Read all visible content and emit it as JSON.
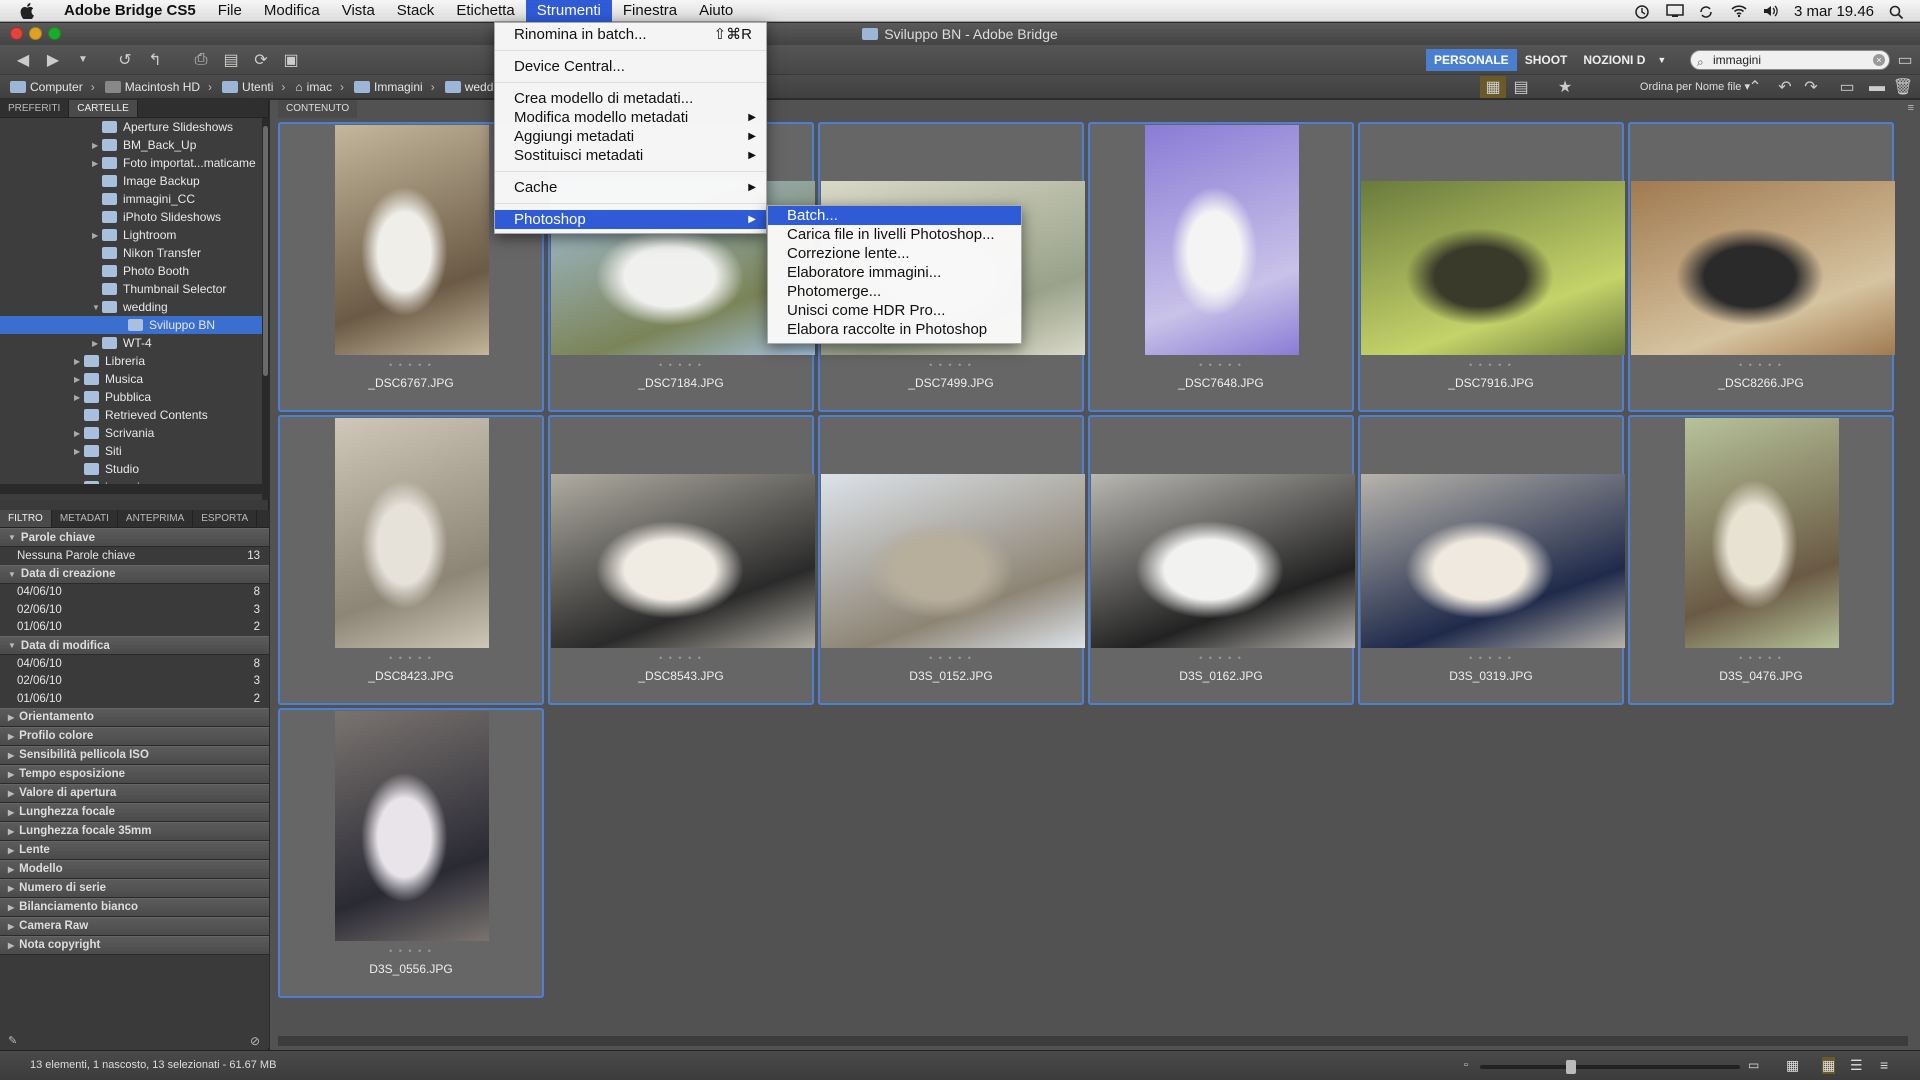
{
  "menubar": {
    "app": "Adobe Bridge CS5",
    "items": [
      "File",
      "Modifica",
      "Vista",
      "Stack",
      "Etichetta",
      "Strumenti",
      "Finestra",
      "Aiuto"
    ],
    "clock": "3 mar 19.46"
  },
  "window": {
    "title": "Sviluppo BN - Adobe Bridge"
  },
  "workspaces": [
    "PERSONALE",
    "SHOOT",
    "NOZIONI D"
  ],
  "search": {
    "value": "immagini"
  },
  "path": [
    "Computer",
    "Macintosh HD",
    "Utenti",
    "imac",
    "Immagini",
    "wedd"
  ],
  "sort_label": "Ordina per Nome file",
  "left_tabs": [
    "PREFERITI",
    "CARTELLE"
  ],
  "tree": [
    {
      "label": "Aperture Slideshows",
      "depth": 2
    },
    {
      "label": "BM_Back_Up",
      "depth": 2,
      "arrow": true
    },
    {
      "label": "Foto importat...maticame",
      "depth": 2,
      "arrow": true
    },
    {
      "label": "Image Backup",
      "depth": 2
    },
    {
      "label": "immagini_CC",
      "depth": 2
    },
    {
      "label": "iPhoto Slideshows",
      "depth": 2
    },
    {
      "label": "Lightroom",
      "depth": 2,
      "arrow": true
    },
    {
      "label": "Nikon Transfer",
      "depth": 2
    },
    {
      "label": "Photo Booth",
      "depth": 2
    },
    {
      "label": "Thumbnail Selector",
      "depth": 2
    },
    {
      "label": "wedding",
      "depth": 2,
      "open": true
    },
    {
      "label": "Sviluppo BN",
      "depth": 3,
      "selected": true
    },
    {
      "label": "WT-4",
      "depth": 2,
      "arrow": true
    },
    {
      "label": "Libreria",
      "depth": 1,
      "arrow": true
    },
    {
      "label": "Musica",
      "depth": 1,
      "arrow": true
    },
    {
      "label": "Pubblica",
      "depth": 1,
      "arrow": true
    },
    {
      "label": "Retrieved Contents",
      "depth": 1
    },
    {
      "label": "Scrivania",
      "depth": 1,
      "arrow": true
    },
    {
      "label": "Siti",
      "depth": 1,
      "arrow": true
    },
    {
      "label": "Studio",
      "depth": 1
    },
    {
      "label": "incoming",
      "depth": 0
    }
  ],
  "filter_tabs": [
    "FILTRO",
    "METADATI",
    "ANTEPRIMA",
    "ESPORTA"
  ],
  "filter": {
    "keywords": {
      "title": "Parole chiave",
      "rows": [
        {
          "label": "Nessuna Parole chiave",
          "count": "13"
        }
      ]
    },
    "created": {
      "title": "Data di creazione",
      "rows": [
        {
          "label": "04/06/10",
          "count": "8"
        },
        {
          "label": "02/06/10",
          "count": "3"
        },
        {
          "label": "01/06/10",
          "count": "2"
        }
      ]
    },
    "modified": {
      "title": "Data di modifica",
      "rows": [
        {
          "label": "04/06/10",
          "count": "8"
        },
        {
          "label": "02/06/10",
          "count": "3"
        },
        {
          "label": "01/06/10",
          "count": "2"
        }
      ]
    },
    "collapsed": [
      "Orientamento",
      "Profilo colore",
      "Sensibilità pellicola ISO",
      "Tempo esposizione",
      "Valore di apertura",
      "Lunghezza focale",
      "Lunghezza focale 35mm",
      "Lente",
      "Modello",
      "Numero di serie",
      "Bilanciamento bianco",
      "Camera Raw",
      "Nota copyright"
    ]
  },
  "content_tab": "CONTENUTO",
  "thumbnails": [
    {
      "name": "_DSC6767.JPG",
      "orient": "portrait",
      "colors": [
        "#c4b79d",
        "#6b5a45",
        "#efeee9"
      ]
    },
    {
      "name": "_DSC7184.JPG",
      "orient": "landscape",
      "colors": [
        "#a6c4e0",
        "#7b8458",
        "#f0f0ee"
      ]
    },
    {
      "name": "_DSC7499.JPG",
      "orient": "landscape",
      "colors": [
        "#d9d9c8",
        "#9aa28a",
        "#f5f5f2"
      ]
    },
    {
      "name": "_DSC7648.JPG",
      "orient": "portrait",
      "colors": [
        "#8a7bd6",
        "#c9c2e8",
        "#f4f4f4"
      ]
    },
    {
      "name": "_DSC7916.JPG",
      "orient": "landscape",
      "colors": [
        "#6a7a3c",
        "#c5d36a",
        "#3a3a2a"
      ]
    },
    {
      "name": "_DSC8266.JPG",
      "orient": "landscape",
      "colors": [
        "#a07a50",
        "#d6c3a0",
        "#2a2a2a"
      ]
    },
    {
      "name": "_DSC8423.JPG",
      "orient": "portrait",
      "colors": [
        "#cfc7b8",
        "#8d8576",
        "#e6e2da"
      ]
    },
    {
      "name": "_DSC8543.JPG",
      "orient": "landscape",
      "colors": [
        "#b0aca2",
        "#2a2a2a",
        "#f0ece4"
      ]
    },
    {
      "name": "D3S_0152.JPG",
      "orient": "landscape",
      "colors": [
        "#dde3ea",
        "#8d8474",
        "#b7ae9c"
      ]
    },
    {
      "name": "D3S_0162.JPG",
      "orient": "landscape",
      "colors": [
        "#b9b7b2",
        "#222",
        "#f2f2f0"
      ]
    },
    {
      "name": "D3S_0319.JPG",
      "orient": "landscape",
      "colors": [
        "#b8b4ac",
        "#1f2a4a",
        "#f0e9df"
      ]
    },
    {
      "name": "D3S_0476.JPG",
      "orient": "portrait",
      "colors": [
        "#b7c39a",
        "#6a5a45",
        "#e8e2d3"
      ]
    },
    {
      "name": "D3S_0556.JPG",
      "orient": "portrait",
      "colors": [
        "#7a7470",
        "#2a2a34",
        "#e8e4ea"
      ]
    }
  ],
  "status": "13 elementi, 1 nascosto, 13 selezionati - 61.67 MB",
  "strumenti_menu": [
    {
      "label": "Rinomina in batch...",
      "shortcut": "⇧⌘R"
    },
    {
      "sep": true
    },
    {
      "label": "Device Central..."
    },
    {
      "sep": true
    },
    {
      "label": "Crea modello di metadati..."
    },
    {
      "label": "Modifica modello metadati",
      "sub": true
    },
    {
      "label": "Aggiungi metadati",
      "sub": true
    },
    {
      "label": "Sostituisci metadati",
      "sub": true
    },
    {
      "sep": true
    },
    {
      "label": "Cache",
      "sub": true
    },
    {
      "sep": true
    },
    {
      "label": "Photoshop",
      "sub": true,
      "hi": true
    }
  ],
  "photoshop_menu": [
    {
      "label": "Batch...",
      "hi": true
    },
    {
      "label": "Carica file in livelli Photoshop..."
    },
    {
      "label": "Correzione lente..."
    },
    {
      "label": "Elaboratore immagini..."
    },
    {
      "label": "Photomerge..."
    },
    {
      "label": "Unisci come HDR Pro..."
    },
    {
      "label": "Elabora raccolte in Photoshop"
    }
  ],
  "accent": "#4d7fd2"
}
